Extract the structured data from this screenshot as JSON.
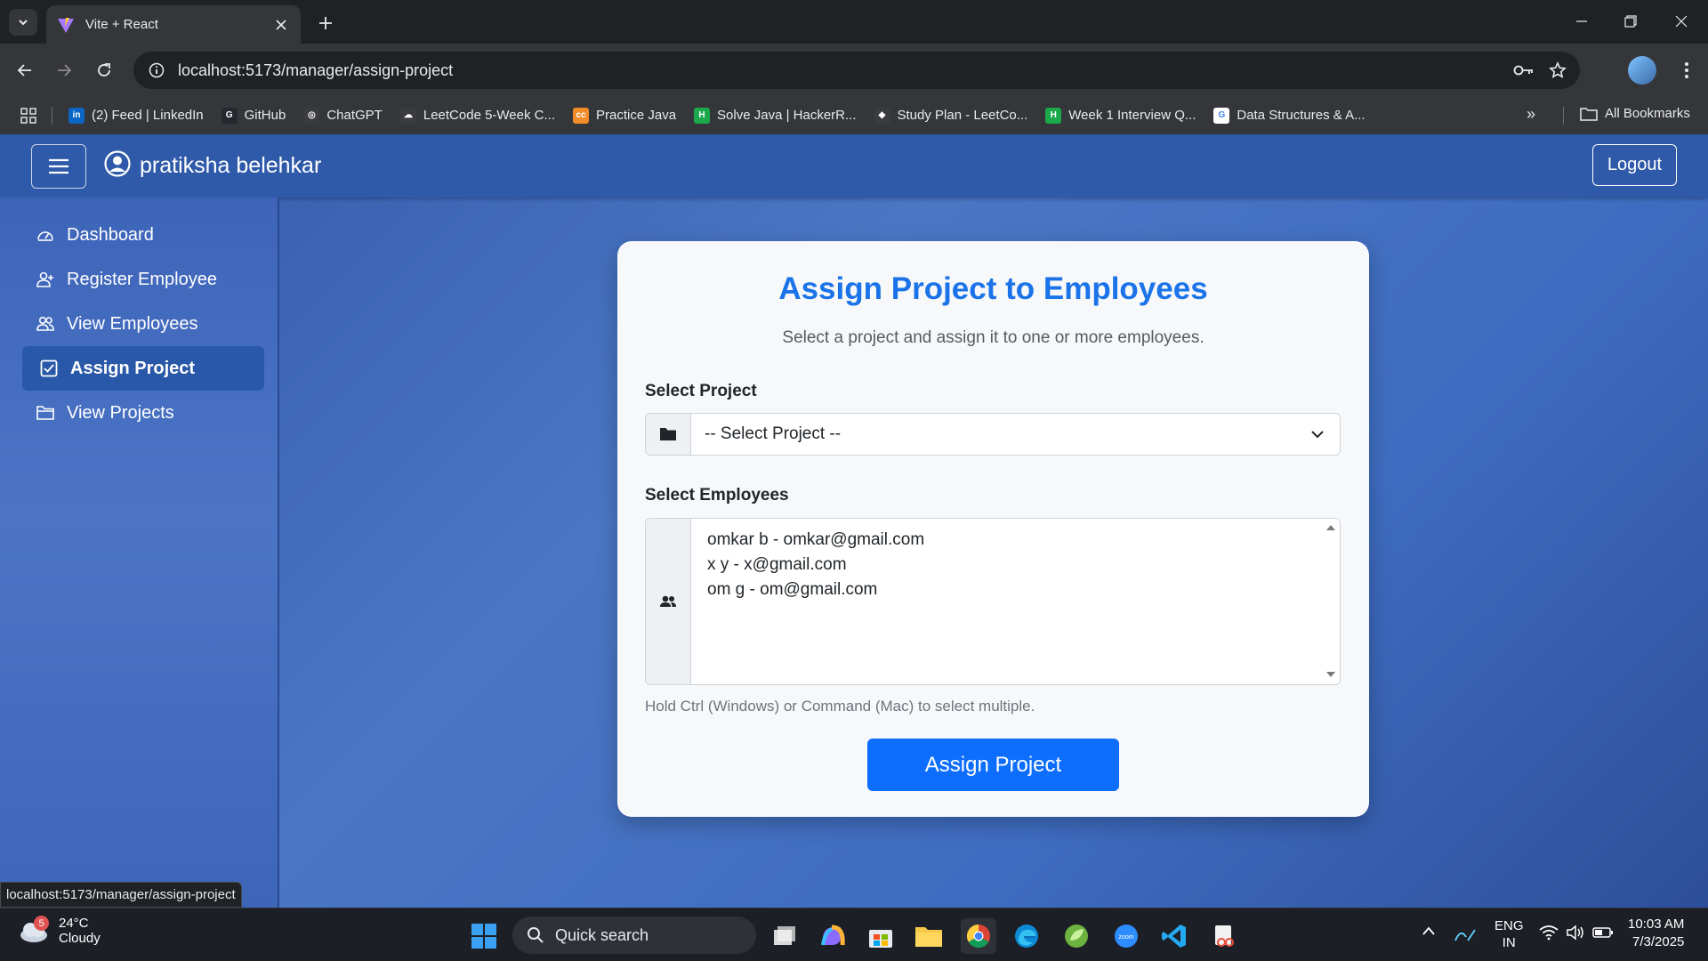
{
  "browser": {
    "tab_title": "Vite + React",
    "url": "localhost:5173/manager/assign-project",
    "bookmarks": [
      {
        "label": "(2) Feed | LinkedIn",
        "color": "#0a66c2",
        "glyph": "in"
      },
      {
        "label": "GitHub",
        "color": "#24292f",
        "glyph": "G"
      },
      {
        "label": "ChatGPT",
        "color": "#3a3b3e",
        "glyph": "◎"
      },
      {
        "label": "LeetCode 5-Week C...",
        "color": "#3a3b3e",
        "glyph": "☁"
      },
      {
        "label": "Practice Java",
        "color": "#f28c28",
        "glyph": "cc"
      },
      {
        "label": "Solve Java | HackerR...",
        "color": "#1ba94c",
        "glyph": "H"
      },
      {
        "label": "Study Plan - LeetCo...",
        "color": "#3a3b3e",
        "glyph": "◆"
      },
      {
        "label": "Week 1 Interview Q...",
        "color": "#1ba94c",
        "glyph": "H"
      },
      {
        "label": "Data Structures & A...",
        "color": "#ffffff",
        "glyph": "G"
      }
    ],
    "all_bookmarks": "All Bookmarks",
    "status_url": "localhost:5173/manager/assign-project"
  },
  "navbar": {
    "user_name": "pratiksha belehkar",
    "logout": "Logout"
  },
  "sidebar": {
    "items": [
      {
        "label": "Dashboard",
        "icon": "speedometer-icon"
      },
      {
        "label": "Register Employee",
        "icon": "person-add-icon"
      },
      {
        "label": "View Employees",
        "icon": "people-icon"
      },
      {
        "label": "Assign Project",
        "icon": "check-square-icon",
        "active": true
      },
      {
        "label": "View Projects",
        "icon": "folder-icon"
      }
    ]
  },
  "form": {
    "title": "Assign Project to Employees",
    "subtitle": "Select a project and assign it to one or more employees.",
    "project_label": "Select Project",
    "project_value": "-- Select Project --",
    "employees_label": "Select Employees",
    "employees": [
      "omkar b - omkar@gmail.com",
      "x y - x@gmail.com",
      "om g - om@gmail.com"
    ],
    "help_text": "Hold Ctrl (Windows) or Command (Mac) to select multiple.",
    "submit": "Assign Project"
  },
  "taskbar": {
    "weather_temp": "24°C",
    "weather_cond": "Cloudy",
    "weather_badge": "5",
    "search_placeholder": "Quick search",
    "lang_top": "ENG",
    "lang_bottom": "IN",
    "time": "10:03 AM",
    "date": "7/3/2025"
  },
  "colors": {
    "accent": "#1a73e8",
    "button": "#0d6efd",
    "navbar": "#2f5aa9"
  }
}
